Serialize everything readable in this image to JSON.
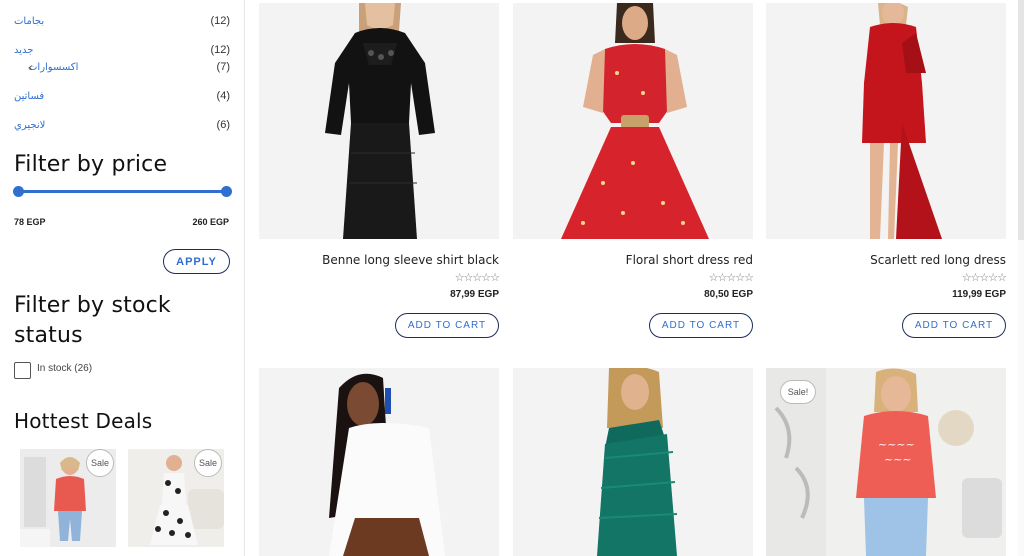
{
  "sidebar": {
    "categories": [
      {
        "label": "بجامات",
        "count": "(12)"
      },
      {
        "label": "جديد",
        "count": "(12)"
      },
      {
        "label": "اكسسوارات",
        "count": "(7)"
      },
      {
        "label": "فساتين",
        "count": "(4)"
      },
      {
        "label": "لانجيري",
        "count": "(6)"
      }
    ],
    "filter_price_title": "Filter by price",
    "price_min": "78 EGP",
    "price_max": "260 EGP",
    "apply_label": "APPLY",
    "filter_stock_title_1": "Filter by stock",
    "filter_stock_title_2": "status",
    "in_stock_label": "In stock (26)",
    "hottest_deals_title": "Hottest Deals",
    "deals": [
      {
        "sale": "Sale"
      },
      {
        "sale": "Sale"
      }
    ]
  },
  "products": [
    {
      "title": "Benne long sleeve shirt black",
      "price": "87,99 EGP",
      "cart": "ADD TO CART",
      "stars": "☆☆☆☆☆"
    },
    {
      "title": "Floral short dress red",
      "price": "80,50 EGP",
      "cart": "ADD TO CART",
      "stars": "☆☆☆☆☆"
    },
    {
      "title": "Scarlett red long dress",
      "price": "119,99 EGP",
      "cart": "ADD TO CART",
      "stars": "☆☆☆☆☆"
    }
  ],
  "bottom_products": [
    {
      "sale": ""
    },
    {
      "sale": ""
    },
    {
      "sale": "Sale!"
    }
  ],
  "colors": {
    "accent": "#2f6fcf",
    "border_dark": "#1e2d5a"
  }
}
